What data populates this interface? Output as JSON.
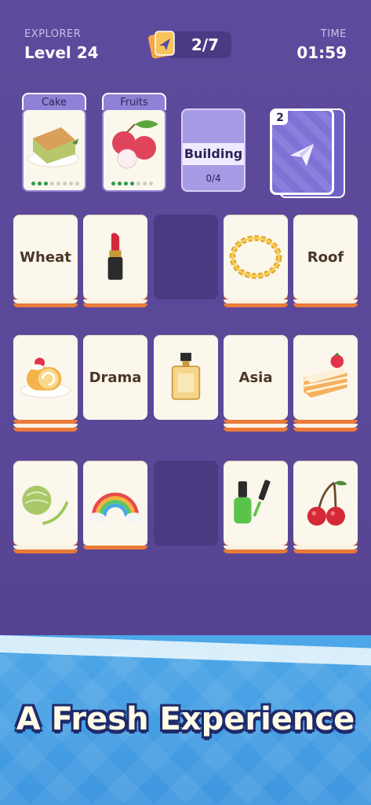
{
  "header": {
    "player_label": "EXPLORER",
    "level": "Level 24",
    "progress": "2/7",
    "time_label": "TIME",
    "time": "01:59"
  },
  "slots": [
    {
      "label": "Cake",
      "icon": "cake-slice-icon",
      "progress": "3/8"
    },
    {
      "label": "Fruits",
      "icon": "lychee-icon",
      "progress": "4/7"
    },
    {
      "label": "Building",
      "count": "0/4"
    }
  ],
  "deck": {
    "count": "2",
    "icon": "paper-plane-icon"
  },
  "board": {
    "row1": [
      {
        "text": "Wheat"
      },
      {
        "icon": "lipstick-icon"
      },
      {
        "empty": true
      },
      {
        "icon": "gold-chain-icon"
      },
      {
        "text": "Roof"
      }
    ],
    "row2": [
      {
        "icon": "swiss-roll-icon"
      },
      {
        "text": "Drama"
      },
      {
        "icon": "perfume-icon"
      },
      {
        "text": "Asia"
      },
      {
        "icon": "strawberry-cake-icon"
      }
    ],
    "row3": [
      {
        "icon": "melon-icon"
      },
      {
        "icon": "rainbow-icon"
      },
      {
        "empty": true
      },
      {
        "icon": "nail-polish-icon"
      },
      {
        "icon": "cherry-icon"
      }
    ]
  },
  "banner": {
    "tagline": "A Fresh Experience"
  }
}
